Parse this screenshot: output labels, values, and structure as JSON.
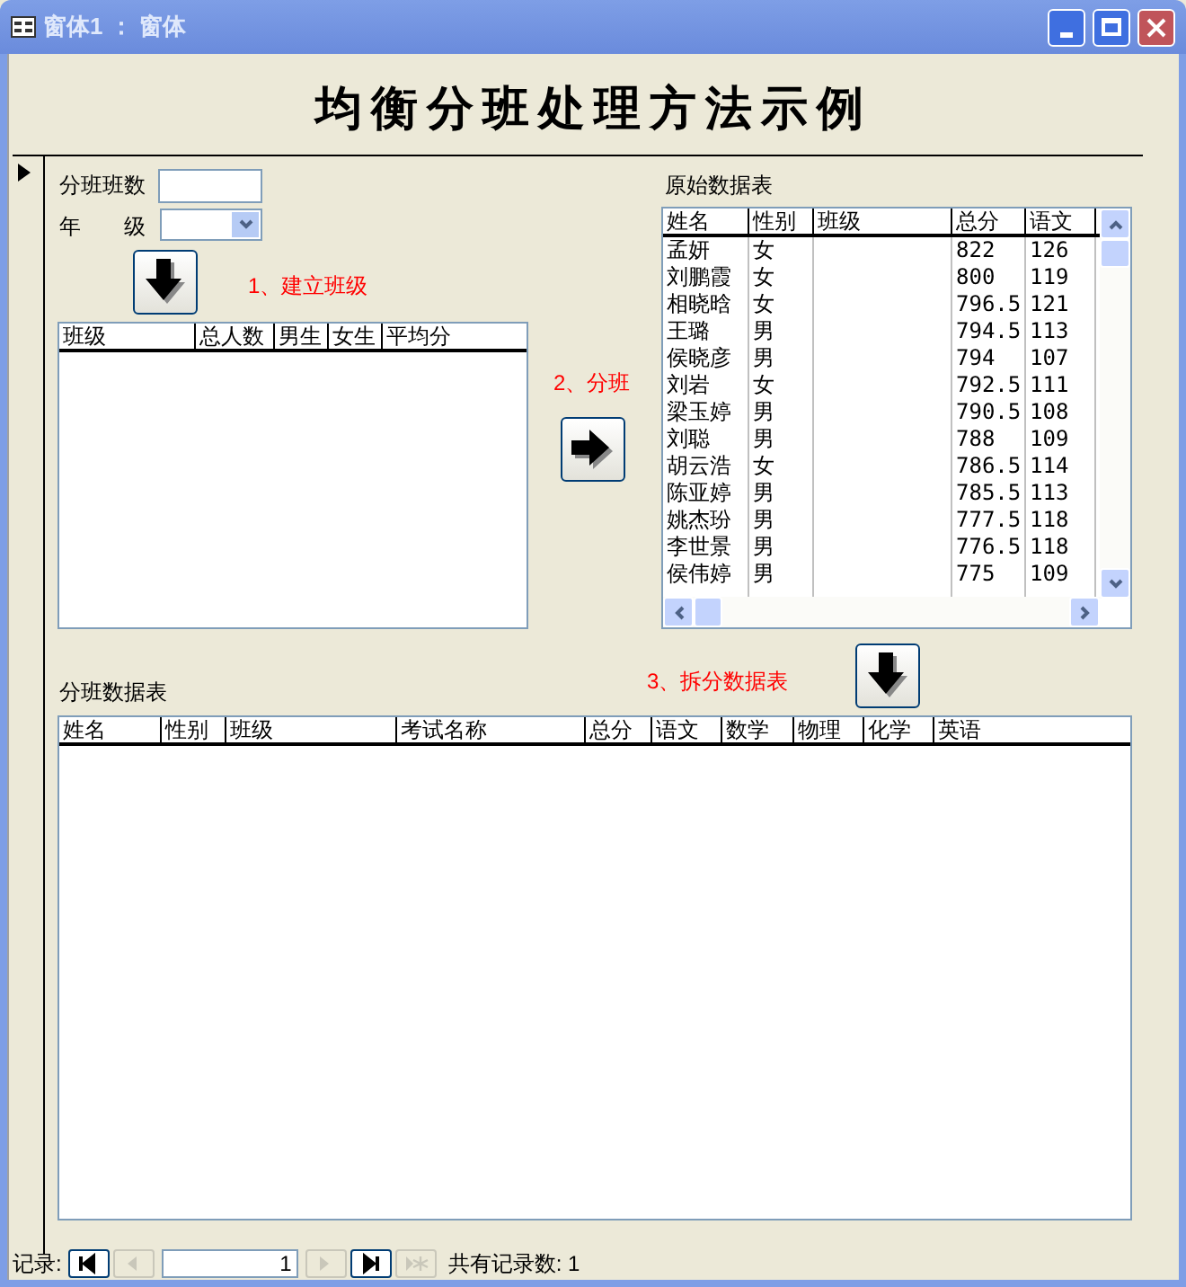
{
  "window": {
    "title": "窗体1 ： 窗体"
  },
  "heading": "均衡分班处理方法示例",
  "class_count": {
    "label": "分班班数"
  },
  "grade": {
    "label": "年　　级"
  },
  "steps": [
    {
      "label": "1、建立班级",
      "kind": "down"
    },
    {
      "label": "2、分班",
      "kind": "right"
    },
    {
      "label": "3、拆分数据表",
      "kind": "down"
    }
  ],
  "class_list": {
    "columns": [
      "班级",
      "总人数",
      "男生",
      "女生",
      "平均分"
    ]
  },
  "source_table": {
    "title": "原始数据表",
    "columns": [
      "姓名",
      "性别",
      "班级",
      "总分",
      "语文"
    ],
    "rows": [
      {
        "name": "孟妍",
        "gender": "女",
        "total": "822",
        "chinese": "126"
      },
      {
        "name": "刘鹏霞",
        "gender": "女",
        "total": "800",
        "chinese": "119"
      },
      {
        "name": "相晓晗",
        "gender": "女",
        "total": "796.5",
        "chinese": "121"
      },
      {
        "name": "王璐",
        "gender": "男",
        "total": "794.5",
        "chinese": "113"
      },
      {
        "name": "侯晓彦",
        "gender": "男",
        "total": "794",
        "chinese": "107"
      },
      {
        "name": "刘岩",
        "gender": "女",
        "total": "792.5",
        "chinese": "111"
      },
      {
        "name": "梁玉婷",
        "gender": "男",
        "total": "790.5",
        "chinese": "108"
      },
      {
        "name": "刘聪",
        "gender": "男",
        "total": "788",
        "chinese": "109"
      },
      {
        "name": "胡云浩",
        "gender": "女",
        "total": "786.5",
        "chinese": "114"
      },
      {
        "name": "陈亚婷",
        "gender": "男",
        "total": "785.5",
        "chinese": "113"
      },
      {
        "name": "姚杰玢",
        "gender": "男",
        "total": "777.5",
        "chinese": "118"
      },
      {
        "name": "李世景",
        "gender": "男",
        "total": "776.5",
        "chinese": "118"
      },
      {
        "name": "侯伟婷",
        "gender": "男",
        "total": "775",
        "chinese": "109"
      }
    ]
  },
  "split_table": {
    "title": "分班数据表",
    "columns": [
      "姓名",
      "性别",
      "班级",
      "考试名称",
      "总分",
      "语文",
      "数学",
      "物理",
      "化学",
      "英语"
    ]
  },
  "navigator": {
    "label": "记录:",
    "current": "1",
    "summary": "共有记录数: 1",
    "buttons": [
      {
        "kind": "first",
        "disabled": false
      },
      {
        "kind": "prev",
        "disabled": true
      },
      {
        "kind": "next",
        "disabled": true
      },
      {
        "kind": "last",
        "disabled": false
      },
      {
        "kind": "new",
        "disabled": true
      }
    ]
  }
}
